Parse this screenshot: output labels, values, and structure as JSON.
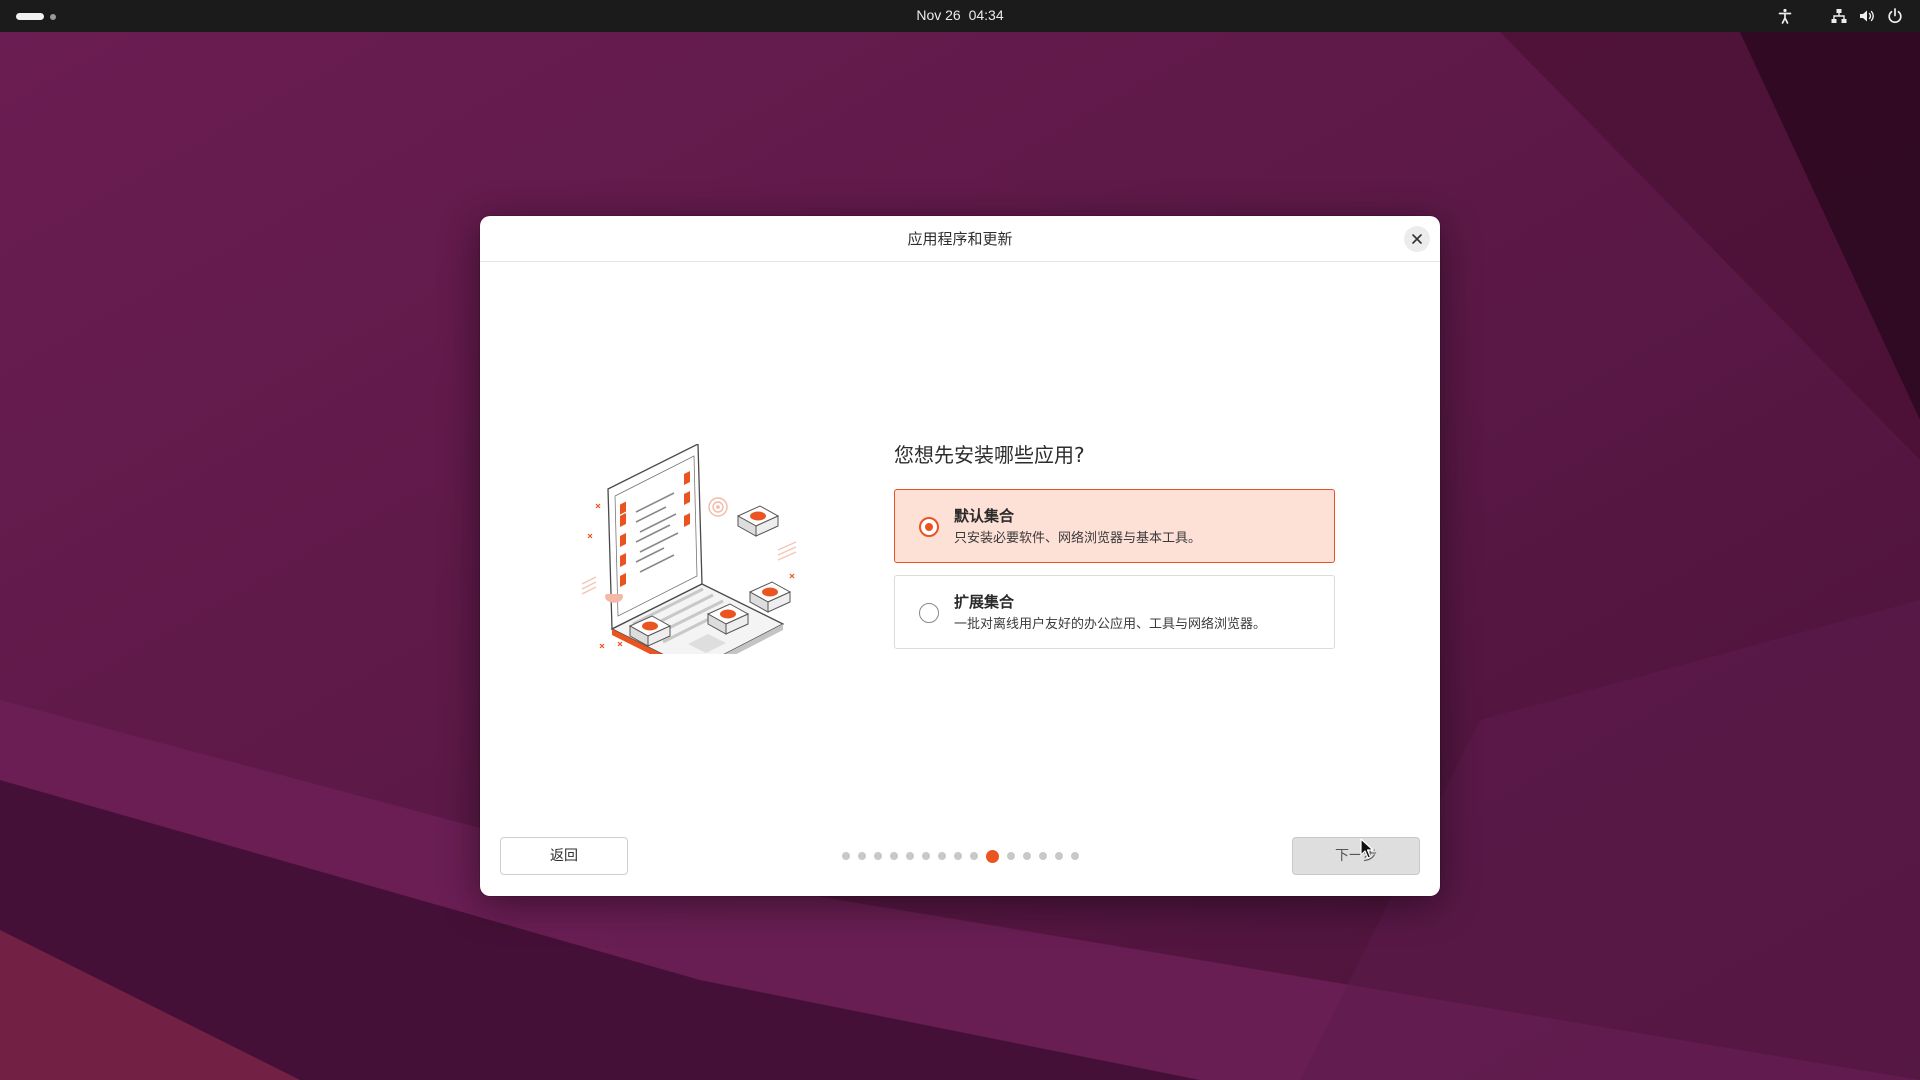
{
  "topbar": {
    "date": "Nov 26",
    "time": "04:34",
    "icons": [
      "accessibility-icon",
      "network-wired-icon",
      "volume-icon",
      "power-icon"
    ]
  },
  "dialog": {
    "title": "应用程序和更新",
    "question": "您想先安装哪些应用?",
    "options": [
      {
        "title": "默认集合",
        "description": "只安装必要软件、网络浏览器与基本工具。",
        "selected": true
      },
      {
        "title": "扩展集合",
        "description": "一批对离线用户友好的办公应用、工具与网络浏览器。",
        "selected": false
      }
    ],
    "back_label": "返回",
    "next_label": "下一步",
    "pager": {
      "total": 15,
      "current": 10
    }
  },
  "colors": {
    "accent": "#e95420",
    "selected_bg": "#fde0d6",
    "topbar_bg": "#1b1b1b",
    "wallpaper": "#5a1a47"
  }
}
